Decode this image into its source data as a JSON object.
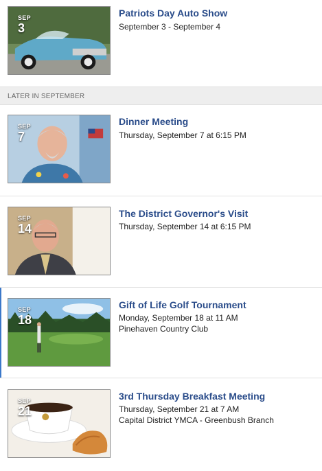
{
  "section_header": "LATER IN SEPTEMBER",
  "events": [
    {
      "month": "SEP",
      "day": "3",
      "title": "Patriots Day Auto Show",
      "when": "September 3 - September 4",
      "where": ""
    },
    {
      "month": "SEP",
      "day": "7",
      "title": "Dinner Meeting",
      "when": "Thursday, September 7 at 6:15 PM",
      "where": ""
    },
    {
      "month": "SEP",
      "day": "14",
      "title": "The District Governor's Visit",
      "when": "Thursday, September 14 at 6:15 PM",
      "where": ""
    },
    {
      "month": "SEP",
      "day": "18",
      "title": "Gift of Life Golf Tournament",
      "when": "Monday, September 18 at 11 AM",
      "where": "Pinehaven Country Club"
    },
    {
      "month": "SEP",
      "day": "21",
      "title": "3rd Thursday Breakfast Meeting",
      "when": "Thursday, September 21 at 7 AM",
      "where": "Capital District YMCA - Greenbush Branch"
    }
  ],
  "colors": {
    "title": "#2a4c8a",
    "section_bg": "#eeeeee",
    "active_bar": "#3b78c9"
  }
}
